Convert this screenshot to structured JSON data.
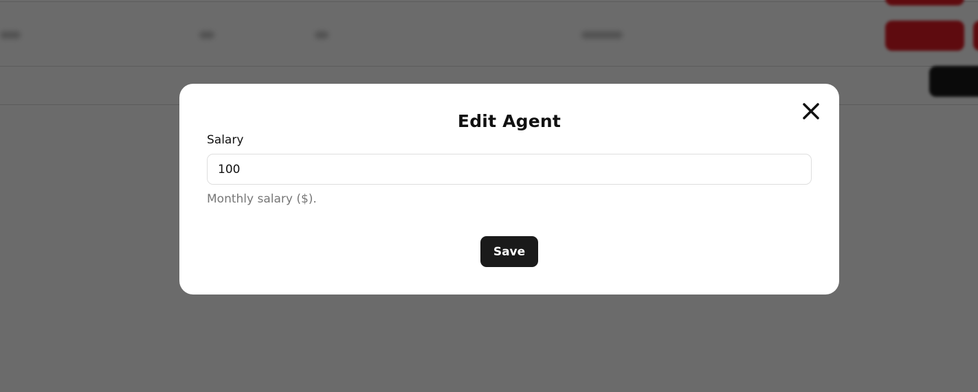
{
  "modal": {
    "title": "Edit Agent",
    "close_icon": "close-icon",
    "salary_field": {
      "label": "Salary",
      "value": "100",
      "help_text": "Monthly salary ($)."
    },
    "save_label": "Save"
  },
  "colors": {
    "danger": "#e01b24",
    "primary_dark": "#1a1a1a",
    "overlay": "rgba(0,0,0,0.58)"
  }
}
